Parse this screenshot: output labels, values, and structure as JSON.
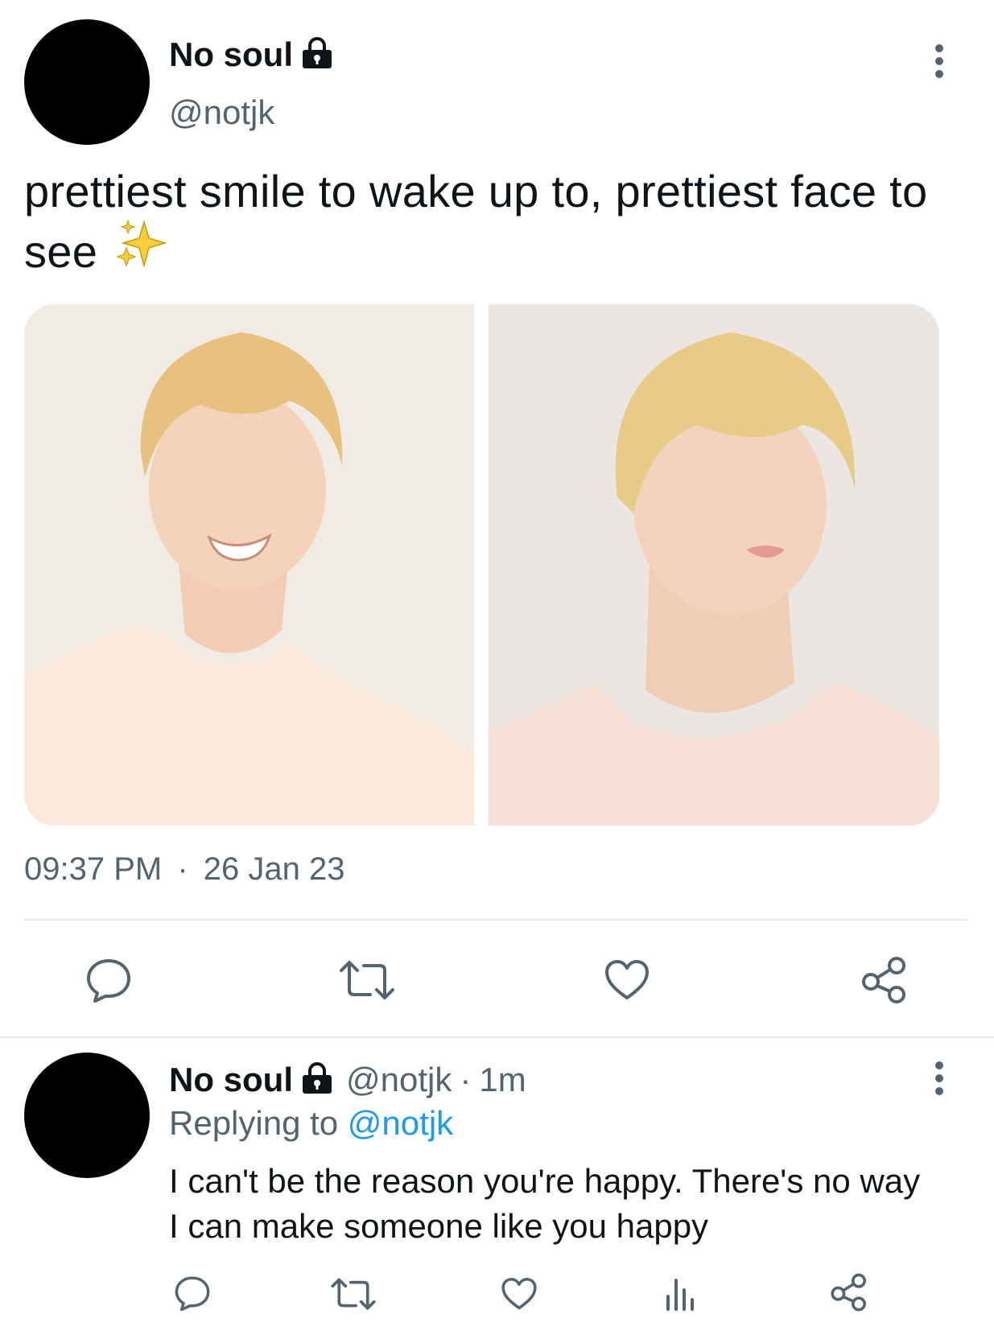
{
  "tweet": {
    "display_name": "No soul",
    "handle": "@notjk",
    "text": "prettiest smile to wake up to, prettiest face to see",
    "emoji": "✨",
    "time": "09:37 PM",
    "separator": "·",
    "date": "26 Jan 23"
  },
  "reply": {
    "display_name": "No soul",
    "handle": "@notjk",
    "separator": "·",
    "age": "1m",
    "replying_prefix": "Replying to",
    "replying_handle": "@notjk",
    "text": "I can't be the reason you're happy. There's no way I can make someone like you happy"
  },
  "icons": {
    "more": "more-vertical-icon",
    "lock": "lock-icon",
    "reply": "reply-icon",
    "retweet": "retweet-icon",
    "like": "like-icon",
    "views": "views-icon",
    "share": "share-icon"
  },
  "colors": {
    "text": "#0f1419",
    "muted": "#536471",
    "link": "#1d9bf0",
    "icon": "#536471"
  }
}
